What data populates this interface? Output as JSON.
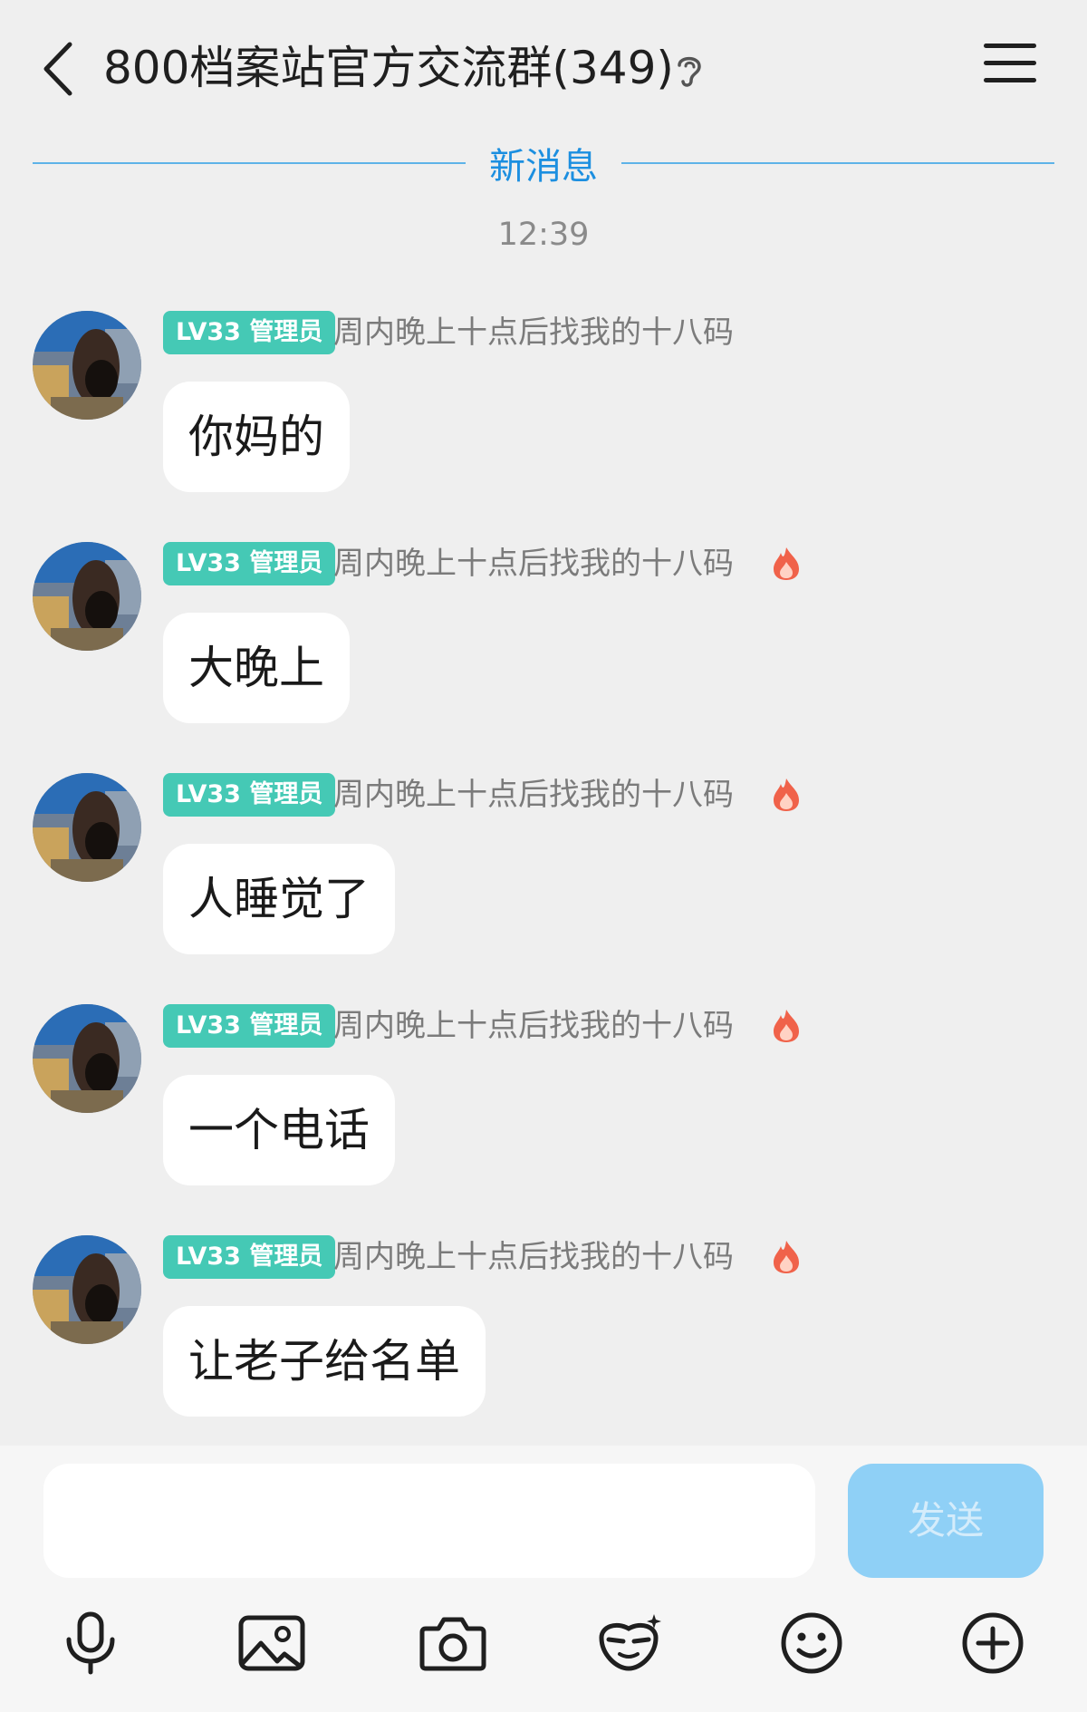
{
  "header": {
    "title": "800档案站官方交流群(349)"
  },
  "divider": {
    "label": "新消息"
  },
  "timestamp": "12:39",
  "messages": [
    {
      "level": "LV33 管理员",
      "nickname": "周内晚上十点后找我的十八码",
      "text": "你妈的",
      "show_fire": false
    },
    {
      "level": "LV33 管理员",
      "nickname": "周内晚上十点后找我的十八码",
      "text": "大晚上",
      "show_fire": true
    },
    {
      "level": "LV33 管理员",
      "nickname": "周内晚上十点后找我的十八码",
      "text": "人睡觉了",
      "show_fire": true
    },
    {
      "level": "LV33 管理员",
      "nickname": "周内晚上十点后找我的十八码",
      "text": "一个电话",
      "show_fire": true
    },
    {
      "level": "LV33 管理员",
      "nickname": "周内晚上十点后找我的十八码",
      "text": "让老子给名单",
      "show_fire": true
    }
  ],
  "composer": {
    "input_value": "",
    "send_label": "发送"
  },
  "toolbar": {
    "items": [
      "microphone-icon",
      "image-icon",
      "camera-icon",
      "mask-icon",
      "emoji-icon",
      "plus-icon"
    ]
  },
  "colors": {
    "background": "#efefef",
    "accent_blue": "#1c8fe0",
    "badge_green": "#45c9b5",
    "send_button": "#8fd0f6"
  }
}
